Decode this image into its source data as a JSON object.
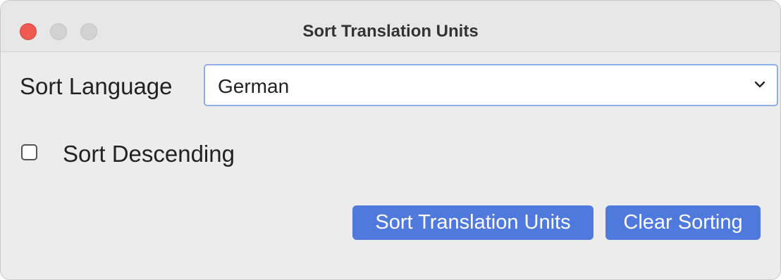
{
  "window": {
    "title": "Sort Translation Units",
    "traffic_colors": {
      "close": "#ee5a52",
      "inactive": "#d2d2d2"
    }
  },
  "form": {
    "sort_language_label": "Sort Language",
    "sort_language_value": "German",
    "sort_descending_label": "Sort Descending",
    "sort_descending_checked": false
  },
  "buttons": {
    "sort_label": "Sort Translation Units",
    "clear_label": "Clear Sorting",
    "accent_color": "#4f79dc"
  },
  "icons": {
    "dropdown": "chevron-down-icon"
  }
}
